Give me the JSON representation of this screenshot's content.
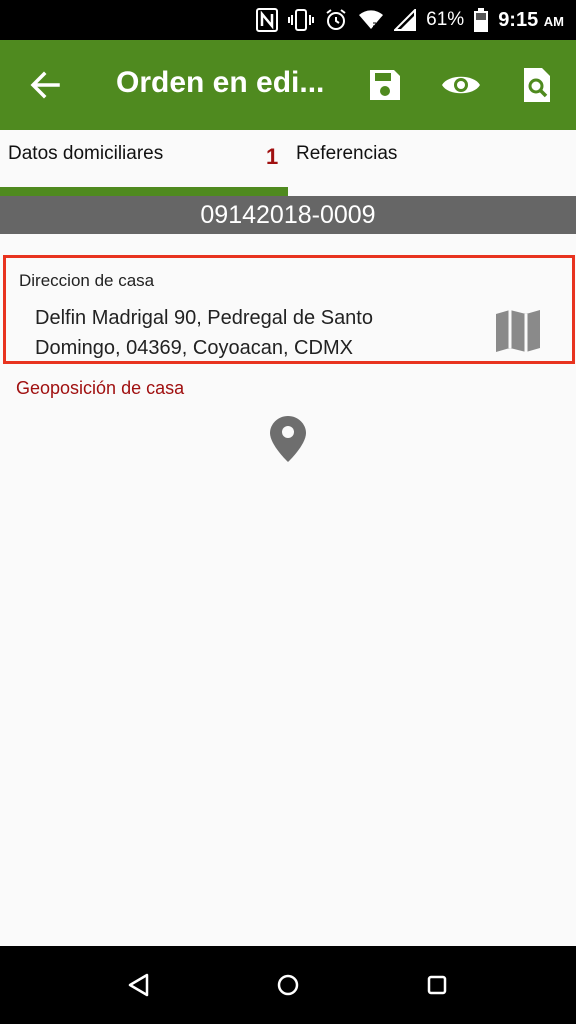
{
  "status_bar": {
    "icons": [
      "nfc-icon",
      "vibrate-icon",
      "alarm-icon",
      "wifi-icon",
      "signal-icon",
      "battery-icon"
    ],
    "battery": "61%",
    "time": "9:15",
    "ampm": "AM"
  },
  "toolbar": {
    "title": "Orden en edi...",
    "back_icon": "arrow-back-icon",
    "actions": [
      "save-icon",
      "eye-icon",
      "search-document-icon"
    ],
    "color": "#4f8a1f"
  },
  "tabs": [
    {
      "label": "Datos domiciliares",
      "selected": true
    },
    {
      "label": "Referencias",
      "selected": false
    }
  ],
  "tab_badge": "1",
  "order_number": "09142018-0009",
  "address": {
    "label": "Direccion de casa",
    "value_line1": "Delfin Madrigal 90, Pedregal de Santo",
    "value_line2": "Domingo, 04369, Coyoacan, CDMX",
    "icon": "map-icon"
  },
  "geoposition": {
    "label": "Geoposición de casa",
    "icon": "location-pin-icon"
  },
  "nav_bar": [
    "back-triangle-icon",
    "home-circle-icon",
    "recents-square-icon"
  ],
  "colors": {
    "primary": "#4f8a1f",
    "highlight_border": "#e8331f",
    "error_text": "#a01010",
    "banner": "#666666"
  }
}
